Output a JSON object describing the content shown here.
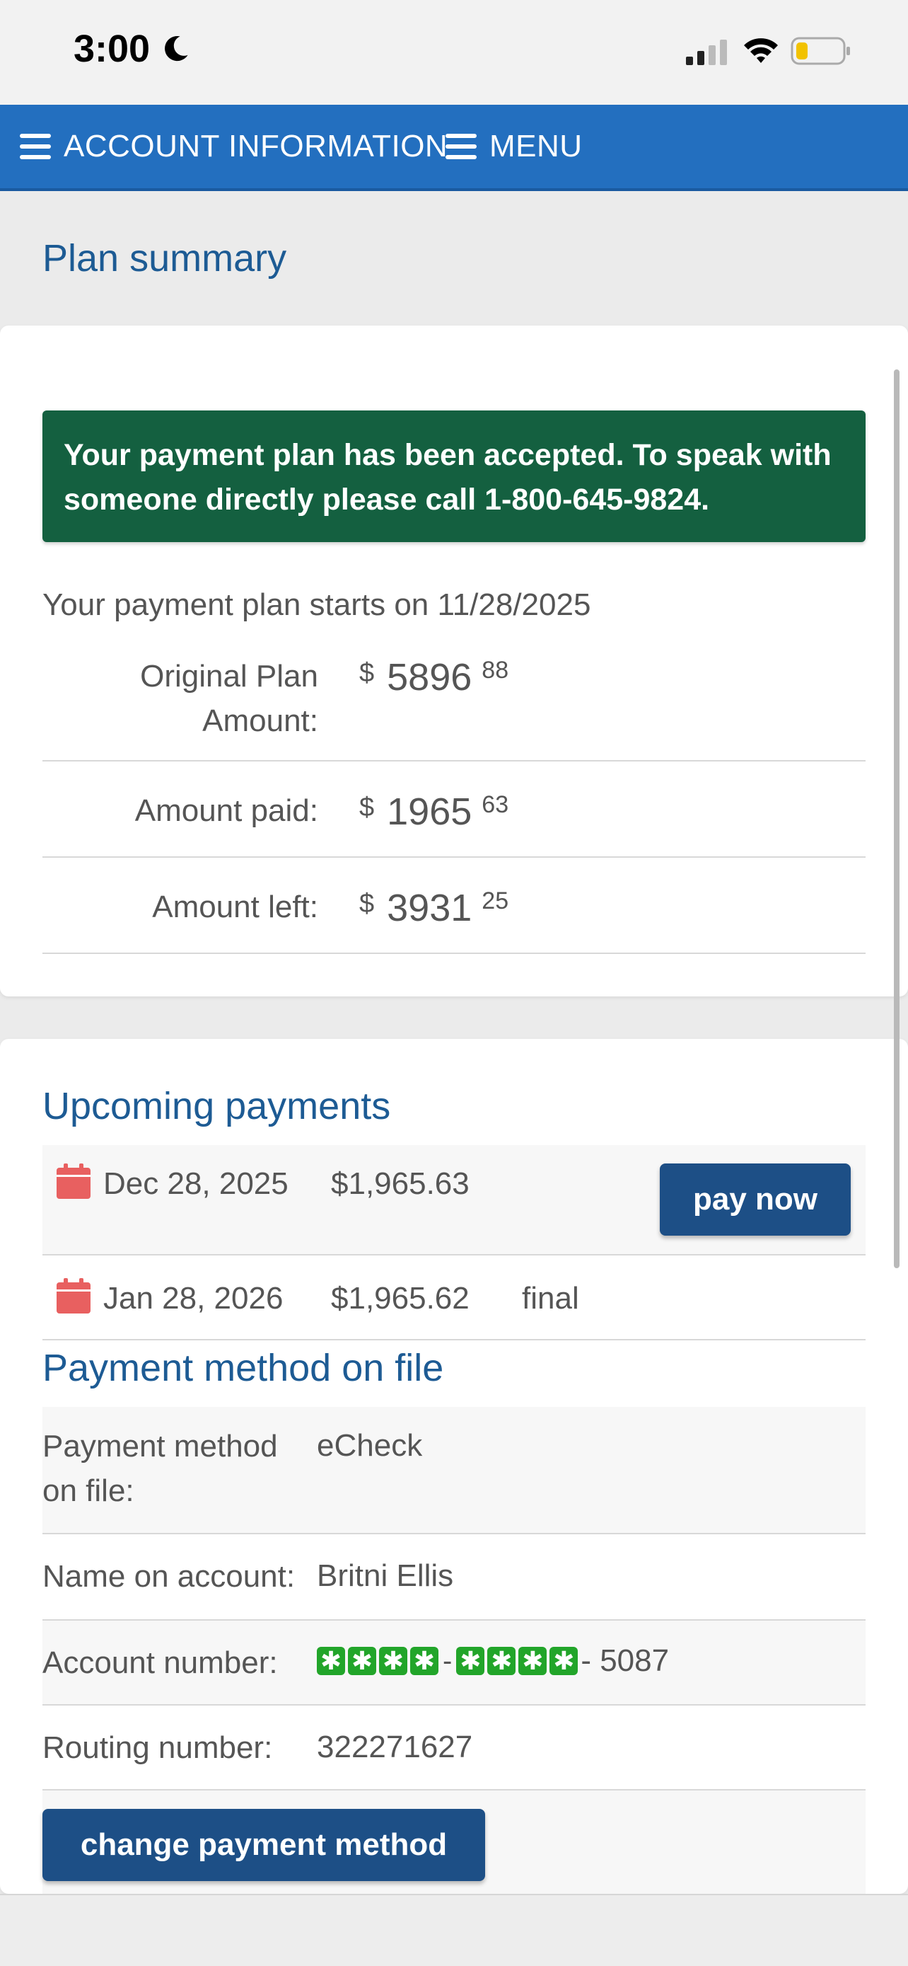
{
  "status_bar": {
    "time": "3:00",
    "icons": [
      "moon-icon",
      "cellular-signal-icon",
      "wifi-icon",
      "battery-low-icon"
    ],
    "battery_color": "#f2c200"
  },
  "nav": {
    "account_label": "ACCOUNT INFORMATION",
    "menu_label": "MENU",
    "background": "#236fbf"
  },
  "page_title": "Plan summary",
  "summary": {
    "alert": "Your payment plan has been accepted. To speak with someone directly please call 1-800-645-9824.",
    "alert_color": "#146040",
    "plan_start": "Your payment plan starts on 11/28/2025",
    "amounts": [
      {
        "label": "Original Plan Amount:",
        "currency": "$",
        "dollars": "5896",
        "cents": "88"
      },
      {
        "label": "Amount paid:",
        "currency": "$",
        "dollars": "1965",
        "cents": "63"
      },
      {
        "label": "Amount left:",
        "currency": "$",
        "dollars": "3931",
        "cents": "25"
      }
    ]
  },
  "upcoming": {
    "title": "Upcoming payments",
    "payments": [
      {
        "date": "Dec 28, 2025",
        "amount": "$1,965.63",
        "note": "",
        "action": "pay now"
      },
      {
        "date": "Jan 28, 2026",
        "amount": "$1,965.62",
        "note": "final",
        "action": ""
      }
    ]
  },
  "payment_method": {
    "title": "Payment method on file",
    "rows": [
      {
        "label": "Payment method on file:",
        "value": "eCheck"
      },
      {
        "label": "Name on account:",
        "value": "Britni Ellis"
      },
      {
        "label": "Account number:",
        "value": "- 5087"
      },
      {
        "label": "Routing number:",
        "value": "322271627"
      }
    ],
    "change_button": "change payment method"
  }
}
